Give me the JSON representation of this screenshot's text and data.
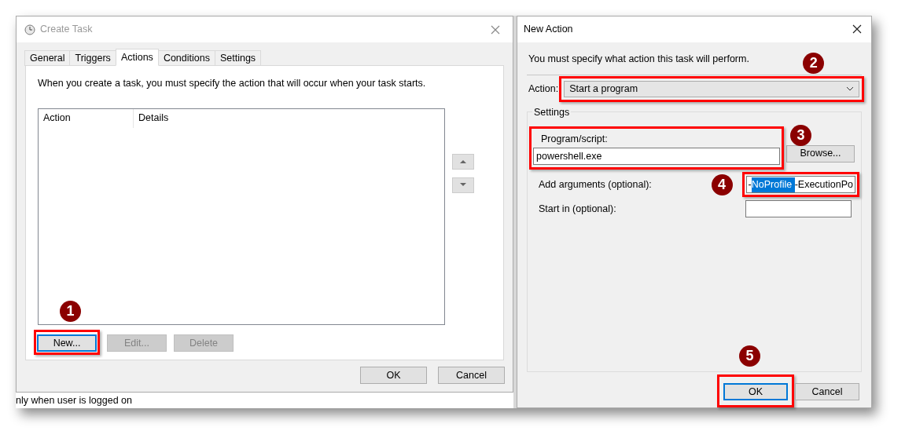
{
  "create_task": {
    "title": "Create Task",
    "tabs": [
      {
        "label": "General",
        "selected": false
      },
      {
        "label": "Triggers",
        "selected": false
      },
      {
        "label": "Actions",
        "selected": true
      },
      {
        "label": "Conditions",
        "selected": false
      },
      {
        "label": "Settings",
        "selected": false
      }
    ],
    "description": "When you create a task, you must specify the action that will occur when your task starts.",
    "table": {
      "columns": [
        "Action",
        "Details"
      ]
    },
    "buttons": [
      {
        "label": "New...",
        "disabled": false,
        "focused": true,
        "highlighted": true,
        "badge": "1"
      },
      {
        "label": "Edit...",
        "disabled": true,
        "focused": false,
        "highlighted": false
      },
      {
        "label": "Delete",
        "disabled": true,
        "focused": false,
        "highlighted": false
      }
    ],
    "footer_buttons": [
      {
        "label": "OK"
      },
      {
        "label": "Cancel"
      }
    ]
  },
  "background_text": "nly when user is logged on",
  "new_action": {
    "title": "New Action",
    "instruction": "You must specify what action this task will perform.",
    "action": {
      "label": "Action:",
      "value": "Start a program",
      "highlighted": true,
      "badge": "2"
    },
    "settings_label": "Settings",
    "program": {
      "label": "Program/script:",
      "value": "powershell.exe",
      "highlighted": true,
      "badge": "3"
    },
    "browse": "Browse...",
    "arguments": {
      "label": "Add arguments (optional):",
      "before": "-",
      "selected_text": "NoProfile ",
      "after": "-ExecutionPo",
      "highlighted": true,
      "badge": "4"
    },
    "start_in": {
      "label": "Start in (optional):"
    },
    "buttons": [
      {
        "label": "OK",
        "focused": true,
        "highlighted": true,
        "badge": "5"
      },
      {
        "label": "Cancel",
        "focused": false,
        "highlighted": false
      }
    ]
  }
}
